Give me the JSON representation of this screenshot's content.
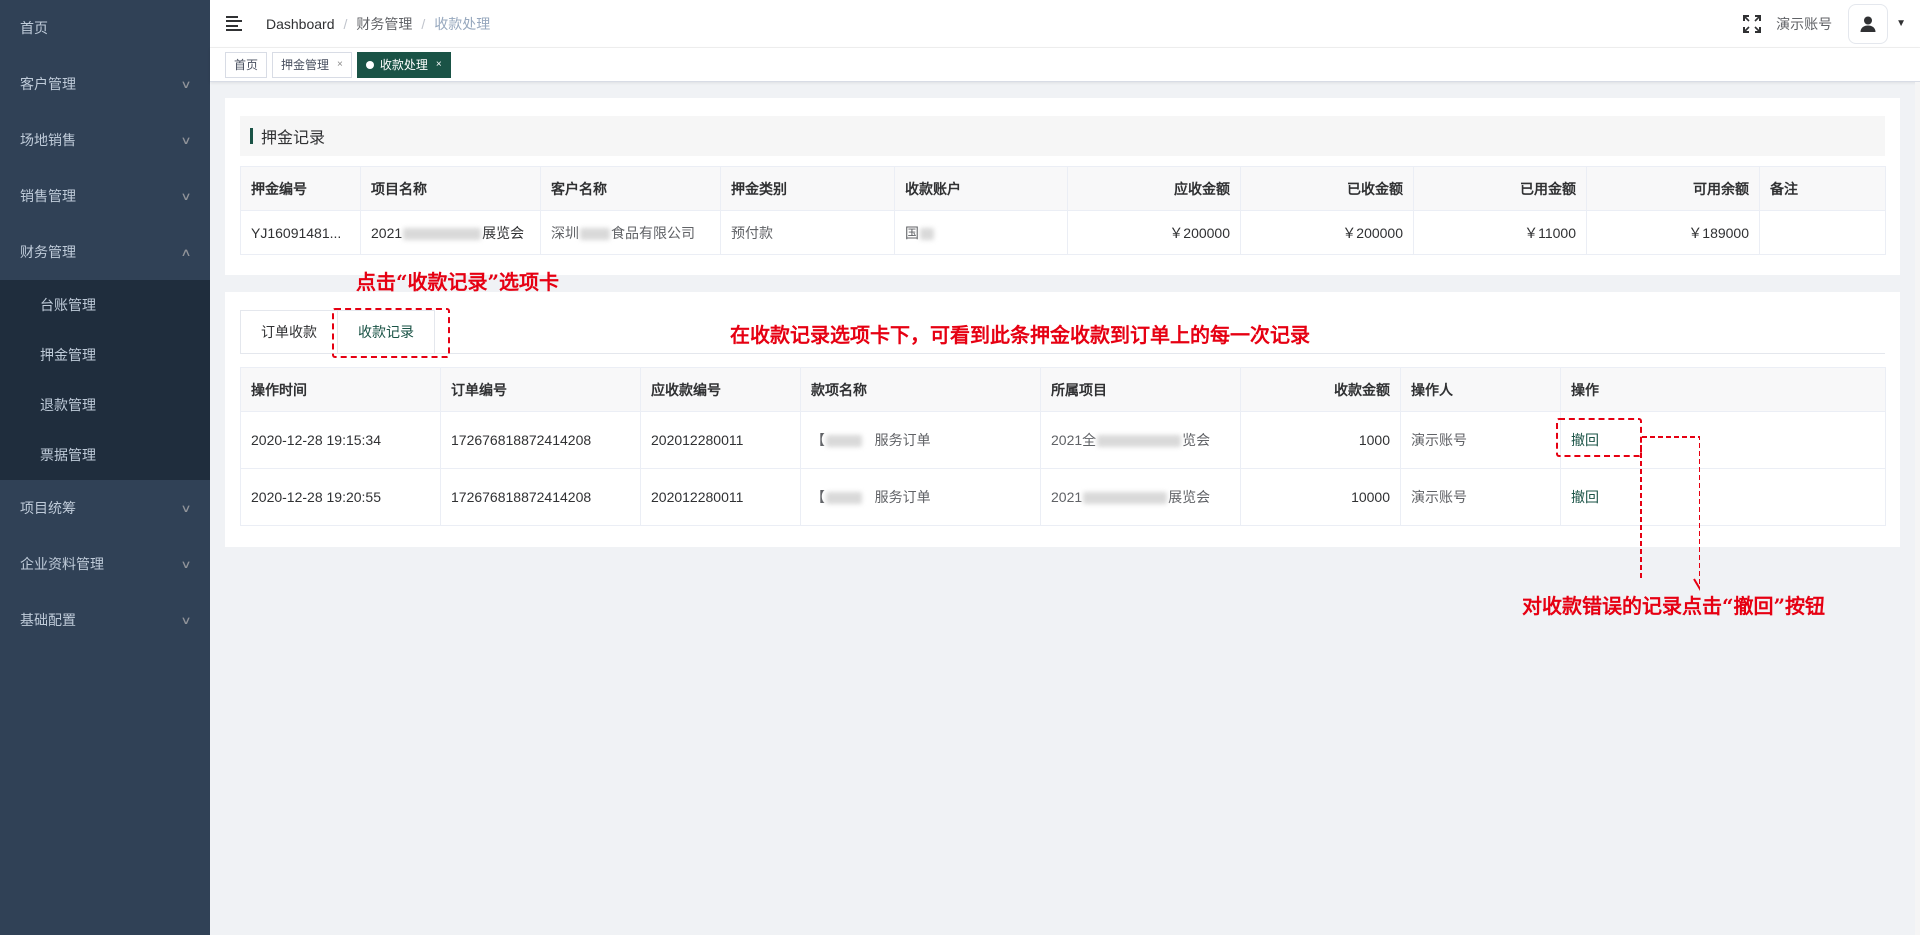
{
  "sidebar": {
    "items": [
      {
        "label": "首页",
        "has_children": false
      },
      {
        "label": "客户管理",
        "has_children": true
      },
      {
        "label": "场地销售",
        "has_children": true
      },
      {
        "label": "销售管理",
        "has_children": true
      },
      {
        "label": "财务管理",
        "has_children": true,
        "expanded": true
      },
      {
        "label": "项目统筹",
        "has_children": true
      },
      {
        "label": "企业资料管理",
        "has_children": true
      },
      {
        "label": "基础配置",
        "has_children": true
      }
    ],
    "finance_children": [
      "台账管理",
      "押金管理",
      "退款管理",
      "票据管理"
    ]
  },
  "header": {
    "breadcrumb": [
      "Dashboard",
      "财务管理",
      "收款处理"
    ],
    "account_name": "演示账号",
    "icons": [
      "hamburger-icon",
      "fullscreen-icon",
      "user-icon",
      "caret-down-icon"
    ]
  },
  "tags": [
    {
      "label": "首页",
      "closable": false,
      "active": false
    },
    {
      "label": "押金管理",
      "closable": true,
      "active": false
    },
    {
      "label": "收款处理",
      "closable": true,
      "active": true
    }
  ],
  "deposit_section": {
    "title": "押金记录",
    "columns": [
      "押金编号",
      "项目名称",
      "客户名称",
      "押金类别",
      "收款账户",
      "应收金额",
      "已收金额",
      "已用金额",
      "可用余额",
      "备注"
    ],
    "row": {
      "deposit_no": "YJ16091481...",
      "project_prefix": "2021",
      "project_suffix": "展览会",
      "customer_prefix": "深圳",
      "customer_suffix": "食品有限公司",
      "category": "预付款",
      "account_prefix": "国",
      "receivable": "￥200000",
      "received": "￥200000",
      "used": "￥11000",
      "available": "￥189000",
      "remark": ""
    }
  },
  "payment_section": {
    "tabs": [
      "订单收款",
      "收款记录"
    ],
    "active_tab": "收款记录",
    "columns": [
      "操作时间",
      "订单编号",
      "应收款编号",
      "款项名称",
      "所属项目",
      "收款金额",
      "操作人",
      "操作"
    ],
    "rows": [
      {
        "time": "2020-12-28 19:15:34",
        "order_no": "172676818872414208",
        "receivable_no": "202012280011",
        "item_prefix": "【",
        "item_suffix": "服务订单",
        "project_prefix": "2021全",
        "project_suffix": "览会",
        "amount": "1000",
        "operator": "演示账号",
        "action": "撤回"
      },
      {
        "time": "2020-12-28 19:20:55",
        "order_no": "172676818872414208",
        "receivable_no": "202012280011",
        "item_prefix": "【",
        "item_suffix": "服务订单",
        "project_prefix": "2021",
        "project_suffix": "展览会",
        "amount": "10000",
        "operator": "演示账号",
        "action": "撤回"
      }
    ]
  },
  "annotations": {
    "tab_hint": "点击“收款记录”选项卡",
    "records_hint": "在收款记录选项卡下，可看到此条押金收款到订单上的每一次记录",
    "withdraw_hint": "对收款错误的记录点击“撤回”按钮"
  },
  "colors": {
    "sidebar_bg": "#304156",
    "submenu_bg": "#1f2d3d",
    "brand_green": "#1a5346",
    "annotation_red": "#e60012"
  }
}
